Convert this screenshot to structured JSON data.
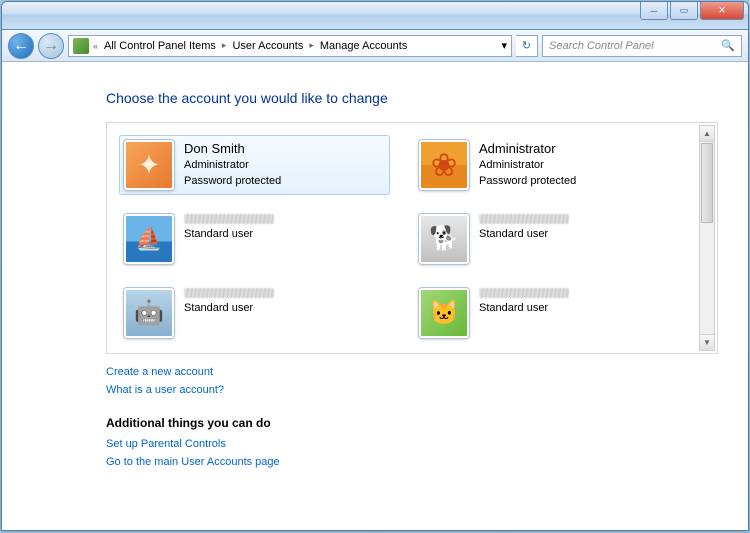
{
  "breadcrumb": {
    "items": [
      "All Control Panel Items",
      "User Accounts",
      "Manage Accounts"
    ]
  },
  "search": {
    "placeholder": "Search Control Panel"
  },
  "heading": "Choose the account you would like to change",
  "accounts": [
    {
      "name": "Don Smith",
      "role": "Administrator",
      "status": "Password protected",
      "blurred": false,
      "selected": true
    },
    {
      "name": "Administrator",
      "role": "Administrator",
      "status": "Password protected",
      "blurred": false,
      "selected": false
    },
    {
      "name": "",
      "role": "Standard user",
      "status": "",
      "blurred": true,
      "selected": false
    },
    {
      "name": "",
      "role": "Standard user",
      "status": "",
      "blurred": true,
      "selected": false
    },
    {
      "name": "",
      "role": "Standard user",
      "status": "",
      "blurred": true,
      "selected": false
    },
    {
      "name": "",
      "role": "Standard user",
      "status": "",
      "blurred": true,
      "selected": false
    }
  ],
  "links": {
    "create": "Create a new account",
    "whatis": "What is a user account?",
    "subhead": "Additional things you can do",
    "parental": "Set up Parental Controls",
    "mainpage": "Go to the main User Accounts page"
  }
}
